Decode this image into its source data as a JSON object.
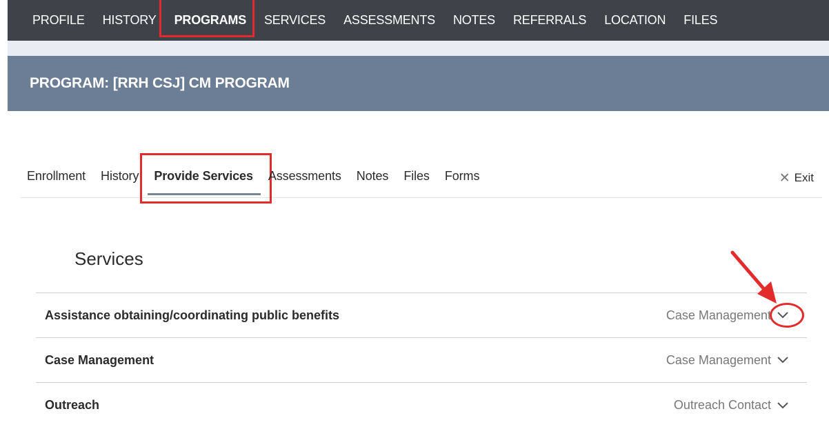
{
  "topnav": {
    "items": [
      {
        "label": "PROFILE"
      },
      {
        "label": "HISTORY"
      },
      {
        "label": "PROGRAMS",
        "active": true
      },
      {
        "label": "SERVICES"
      },
      {
        "label": "ASSESSMENTS"
      },
      {
        "label": "NOTES"
      },
      {
        "label": "REFERRALS"
      },
      {
        "label": "LOCATION"
      },
      {
        "label": "FILES"
      }
    ]
  },
  "program": {
    "title": "PROGRAM: [RRH CSJ] CM PROGRAM"
  },
  "subtabs": {
    "items": [
      {
        "label": "Enrollment"
      },
      {
        "label": "History"
      },
      {
        "label": "Provide Services",
        "active": true
      },
      {
        "label": "Assessments"
      },
      {
        "label": "Notes"
      },
      {
        "label": "Files"
      },
      {
        "label": "Forms"
      }
    ],
    "exit_label": "Exit",
    "exit_icon": "close-icon"
  },
  "services": {
    "heading": "Services",
    "rows": [
      {
        "name": "Assistance obtaining/coordinating public benefits",
        "type": "Case Management"
      },
      {
        "name": "Case Management",
        "type": "Case Management"
      },
      {
        "name": "Outreach",
        "type": "Outreach Contact"
      }
    ]
  },
  "colors": {
    "topnav_bg": "#3f4349",
    "header_bg": "#6b7e95",
    "annotation": "#e32b2b"
  }
}
